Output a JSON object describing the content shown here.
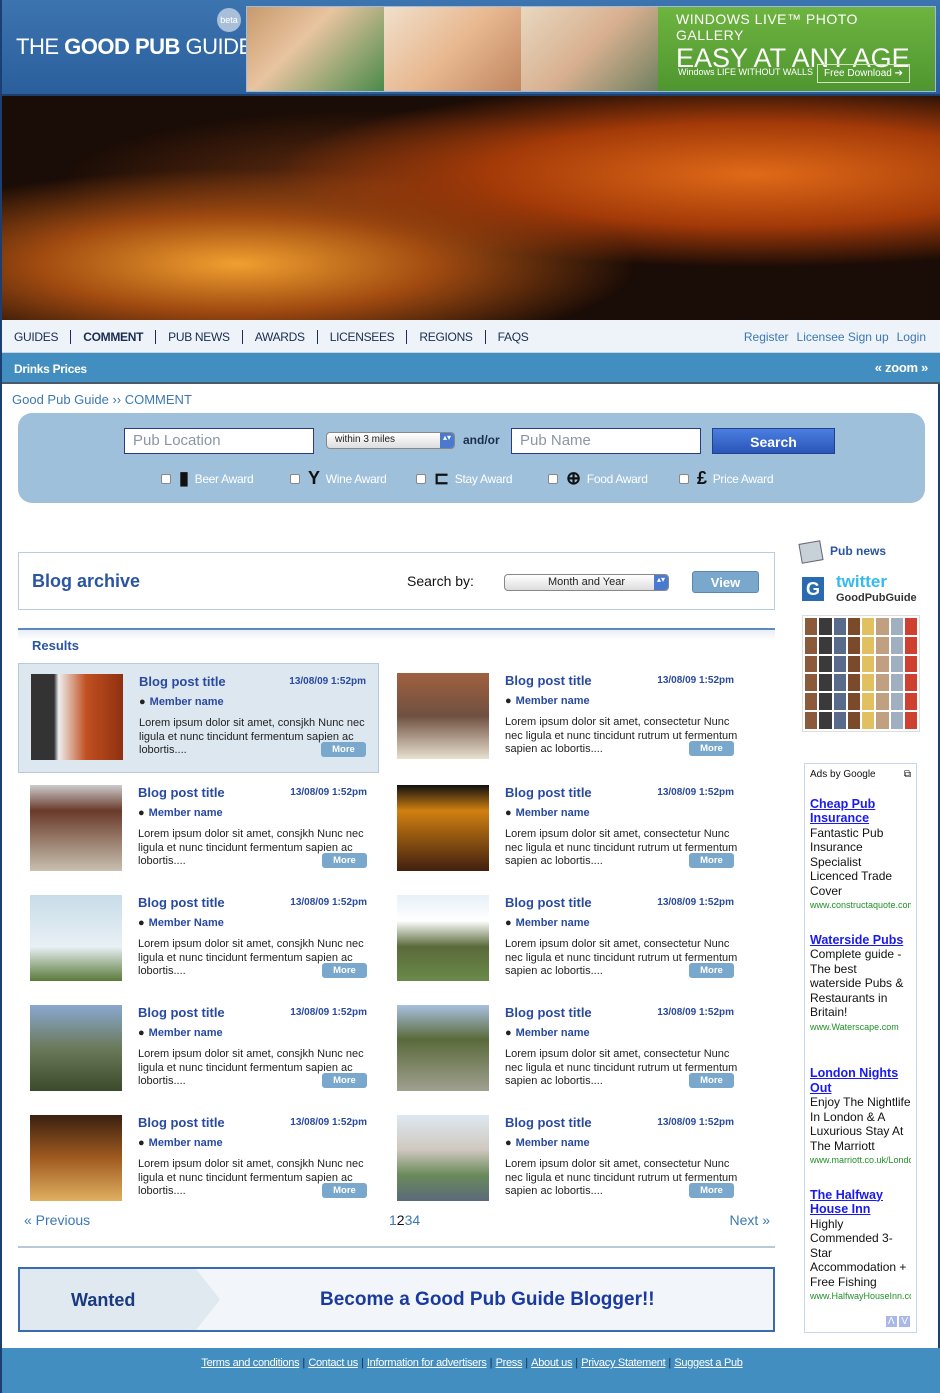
{
  "header": {
    "logo_light1": "THE ",
    "logo_bold": "GOOD PUB",
    "logo_light2": " GUIDE",
    "beta": "beta"
  },
  "banner_ad": {
    "line1": "WINDOWS LIVE™ PHOTO GALLERY",
    "line2": "EASY AT ANY AGE",
    "tagline": "Windows  LIFE WITHOUT WALLS",
    "cta": "Free Download ➔"
  },
  "nav": {
    "items": [
      "GUIDES",
      "COMMENT",
      "PUB NEWS",
      "AWARDS",
      "LICENSEES",
      "REGIONS",
      "FAQS"
    ],
    "active": "COMMENT",
    "right": [
      "Register",
      "Licensee Sign up",
      "Login"
    ]
  },
  "subbar": {
    "title": "Drinks Prices",
    "zoom": "« zoom »"
  },
  "breadcrumb": "Good Pub Guide ›› COMMENT",
  "search": {
    "location_placeholder": "Pub Location",
    "distance": "within 3 miles",
    "andor": "and/or",
    "name_placeholder": "Pub Name",
    "button": "Search",
    "awards": [
      {
        "label": "Beer Award",
        "icon": "beer-mug-icon"
      },
      {
        "label": "Wine Award",
        "icon": "wine-glass-icon"
      },
      {
        "label": "Stay Award",
        "icon": "bed-icon"
      },
      {
        "label": "Food Award",
        "icon": "knife-fork-icon"
      },
      {
        "label": "Price Award",
        "icon": "pound-icon"
      }
    ]
  },
  "archive": {
    "title": "Blog archive",
    "search_by": "Search by:",
    "select": "Month and Year",
    "view": "View"
  },
  "results": {
    "label": "Results",
    "posts": [
      {
        "title": "Blog post title",
        "date": "13/08/09  1:52pm",
        "member": "Member name",
        "text": "Lorem ipsum dolor sit amet, consjkh Nunc nec ligula et nunc tincidunt fermentum sapien ac lobortis....",
        "more": "More"
      },
      {
        "title": "Blog post title",
        "date": "13/08/09  1:52pm",
        "member": "Member name",
        "text": "Lorem ipsum dolor sit amet, consectetur Nunc nec ligula et nunc tincidunt rutrum ut fermentum sapien ac lobortis....",
        "more": "More"
      },
      {
        "title": "Blog post title",
        "date": "13/08/09  1:52pm",
        "member": "Member name",
        "text": "Lorem ipsum dolor sit amet, consjkh Nunc nec ligula et nunc tincidunt fermentum sapien ac lobortis....",
        "more": "More"
      },
      {
        "title": "Blog post title",
        "date": "13/08/09  1:52pm",
        "member": "Member name",
        "text": "Lorem ipsum dolor sit amet, consectetur Nunc nec ligula et nunc tincidunt rutrum ut fermentum sapien ac lobortis....",
        "more": "More"
      },
      {
        "title": "Blog post title",
        "date": "13/08/09  1:52pm",
        "member": "Member Name",
        "text": "Lorem ipsum dolor sit amet, consjkh Nunc nec ligula et nunc tincidunt fermentum sapien ac lobortis....",
        "more": "More"
      },
      {
        "title": "Blog post title",
        "date": "13/08/09  1:52pm",
        "member": "Member name",
        "text": "Lorem ipsum dolor sit amet, consectetur Nunc nec ligula et nunc tincidunt rutrum ut fermentum sapien ac lobortis....",
        "more": "More"
      },
      {
        "title": "Blog post title",
        "date": "13/08/09  1:52pm",
        "member": "Member name",
        "text": "Lorem ipsum dolor sit amet, consjkh Nunc nec ligula et nunc tincidunt fermentum sapien ac lobortis....",
        "more": "More"
      },
      {
        "title": "Blog post title",
        "date": "13/08/09  1:52pm",
        "member": "Member name",
        "text": "Lorem ipsum dolor sit amet, consectetur Nunc nec ligula et nunc tincidunt rutrum ut fermentum sapien ac lobortis....",
        "more": "More"
      },
      {
        "title": "Blog post title",
        "date": "13/08/09  1:52pm",
        "member": "Member name",
        "text": "Lorem ipsum dolor sit amet, consjkh Nunc nec ligula et nunc tincidunt fermentum sapien ac lobortis....",
        "more": "More"
      },
      {
        "title": "Blog post title",
        "date": "13/08/09  1:52pm",
        "member": "Member name",
        "text": "Lorem ipsum dolor sit amet, consectetur Nunc nec ligula et nunc tincidunt rutrum ut fermentum sapien ac lobortis....",
        "more": "More"
      }
    ]
  },
  "pager": {
    "previous": "« Previous",
    "pages": [
      "1",
      "2",
      "3",
      "4"
    ],
    "current": "2",
    "next": "Next »"
  },
  "wanted": {
    "label": "Wanted",
    "cta": "Become a Good Pub Guide Blogger!!"
  },
  "sidebar": {
    "pub_news": "Pub news",
    "twitter": "twitter",
    "twitter_handle": "GoodPubGuide",
    "ads_by": "Ads by Google",
    "ads": [
      {
        "title": "Cheap Pub Insurance",
        "desc": "Fantastic Pub Insurance Specialist Licenced Trade Cover",
        "url": "www.constructaquote.com"
      },
      {
        "title": "Waterside Pubs",
        "desc": "Complete guide - The best waterside Pubs & Restaurants in Britain!",
        "url": "www.Waterscape.com"
      },
      {
        "title": "London Nights Out",
        "desc": "Enjoy The Nightlife In London & A Luxurious Stay At The Marriott",
        "url": "www.marriott.co.uk/London"
      },
      {
        "title": "The Halfway House Inn",
        "desc": "Highly Commended 3-Star Accommodation + Free Fishing",
        "url": "www.HalfwayHouseInn.co.uk"
      }
    ]
  },
  "footer": {
    "links": [
      "Terms and conditions",
      "Contact us",
      "Information for advertisers",
      "Press",
      "About us",
      "Privacy Statement",
      "Suggest a Pub"
    ]
  }
}
